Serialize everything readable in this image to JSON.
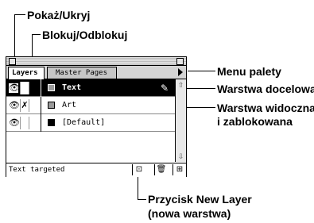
{
  "callouts": {
    "show_hide": "Pokaż/Ukryj",
    "lock_unlock": "Blokuj/Odblokuj",
    "palette_menu": "Menu palety",
    "target_layer": "Warstwa docelowa;",
    "visible_locked_1": "Warstwa widoczna",
    "visible_locked_2": "i zablokowana",
    "new_layer_1": "Przycisk New Layer",
    "new_layer_2": "(nowa warstwa)"
  },
  "palette": {
    "tabs": [
      {
        "label": "Layers",
        "active": true
      },
      {
        "label": "Master Pages",
        "active": false
      }
    ],
    "layers": [
      {
        "name": "Text",
        "selected": true,
        "swatch_color": "#9a9a9a",
        "locked": false
      },
      {
        "name": "Art",
        "selected": false,
        "swatch_color": "#9a9a9a",
        "locked": true
      },
      {
        "name": "[Default]",
        "selected": false,
        "swatch_color": "#000000",
        "locked": false
      }
    ],
    "status": "Text targeted",
    "icons": {
      "eye": "👁",
      "lock": "✗",
      "pen": "✎",
      "new_layer": "⊡",
      "trash": "🗑",
      "resize": "⊞"
    }
  }
}
